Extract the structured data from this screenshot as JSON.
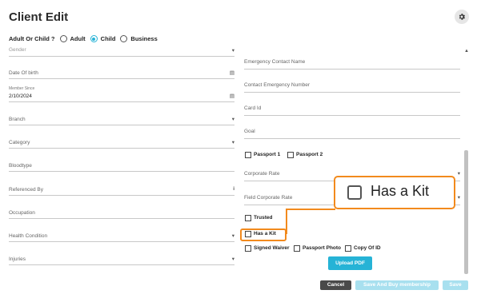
{
  "header": {
    "title": "Client Edit",
    "settings_icon": "gear-icon"
  },
  "client_type": {
    "label": "Adult Or Child ?",
    "options": [
      "Adult",
      "Child",
      "Business"
    ],
    "selected": "Child"
  },
  "left_fields": {
    "gender": "Gender",
    "dob": "Date Of birth",
    "member_since_label": "Member Since",
    "member_since_value": "2/10/2024",
    "branch": "Branch",
    "category": "Category",
    "bloodtype": "Bloodtype",
    "referenced_by": "Referenced By",
    "occupation": "Occupation",
    "health_condition": "Health Condition",
    "injuries": "Injuries"
  },
  "right_fields": {
    "emergency_contact_name": "Emergency Contact Name",
    "contact_emergency_number": "Contact Emergency Number",
    "card_id": "Card Id",
    "goal": "Goal",
    "corporate_rate": "Corporate Rate",
    "field_corporate_rate": "Field Corporate Rate"
  },
  "checkboxes": {
    "passport1": "Passport 1",
    "passport2": "Passport 2",
    "trusted": "Trusted",
    "has_kit": "Has a Kit",
    "signed_waiver": "Signed Waiver",
    "passport_photo": "Passport Photo",
    "copy_of_id": "Copy Of ID"
  },
  "callout": {
    "label": "Has a Kit"
  },
  "buttons": {
    "upload_pdf": "Upload PDF",
    "cancel": "Cancel",
    "save_and_buy": "Save And Buy membership",
    "save": "Save"
  },
  "colors": {
    "accent": "#26b3d6",
    "cancel": "#4a4a4a",
    "disabled": "#a8e0ef",
    "callout": "#f28a1d"
  }
}
